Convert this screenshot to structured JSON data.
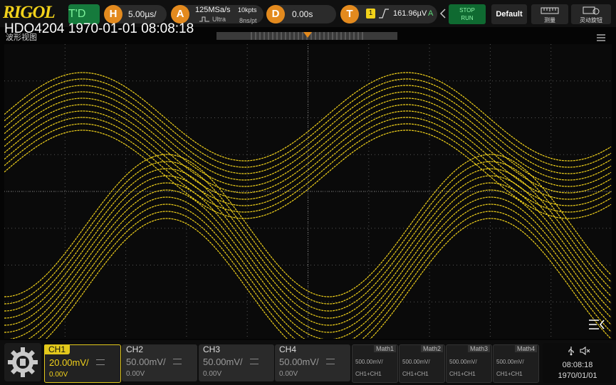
{
  "header": {
    "logo": "RIGOL",
    "trigger_status": "T'D",
    "timebase": {
      "label": "H",
      "value": "5.00µs/"
    },
    "acquisition": {
      "label": "A",
      "sample_rate": "125MSa/s",
      "mode": "Ultra",
      "memory_depth": "10kpts",
      "time_per_point": "8ns/pt"
    },
    "delay": {
      "label": "D",
      "value": "0.00s"
    },
    "trigger": {
      "label": "T",
      "source": "1",
      "level": "161.96µV",
      "coupling": "A"
    },
    "buttons": {
      "stop_run_top": "STOP",
      "stop_run_bottom": "RUN",
      "default": "Default",
      "measure": "测量",
      "shortcut": "灵动旋钮"
    },
    "title_overlay": "HDO4204 1970-01-01 08:08:18",
    "view_label": "波形视图"
  },
  "waveform": {
    "color": "#f2d21b",
    "background": "#0a0a0a",
    "grid": "dotted, 10 x 8 divisions"
  },
  "channels": [
    {
      "label": "CH1",
      "scale": "20.00mV/",
      "offset": "0.00V",
      "active": true,
      "color": "#f2d21b"
    },
    {
      "label": "CH2",
      "scale": "50.00mV/",
      "offset": "0.00V",
      "active": false
    },
    {
      "label": "CH3",
      "scale": "50.00mV/",
      "offset": "0.00V",
      "active": false
    },
    {
      "label": "CH4",
      "scale": "50.00mV/",
      "offset": "0.00V",
      "active": false
    }
  ],
  "maths": [
    {
      "label": "Math1",
      "scale": "500.00mV/",
      "expr": "CH1+CH1"
    },
    {
      "label": "Math2",
      "scale": "500.00mV/",
      "expr": "CH1+CH1"
    },
    {
      "label": "Math3",
      "scale": "500.00mV/",
      "expr": "CH1+CH1"
    },
    {
      "label": "Math4",
      "scale": "500.00mV/",
      "expr": "CH1+CH1"
    }
  ],
  "status": {
    "time": "08:08:18",
    "date": "1970/01/01",
    "usb_icon": "usb-icon",
    "mute_icon": "speaker-mute-icon"
  }
}
